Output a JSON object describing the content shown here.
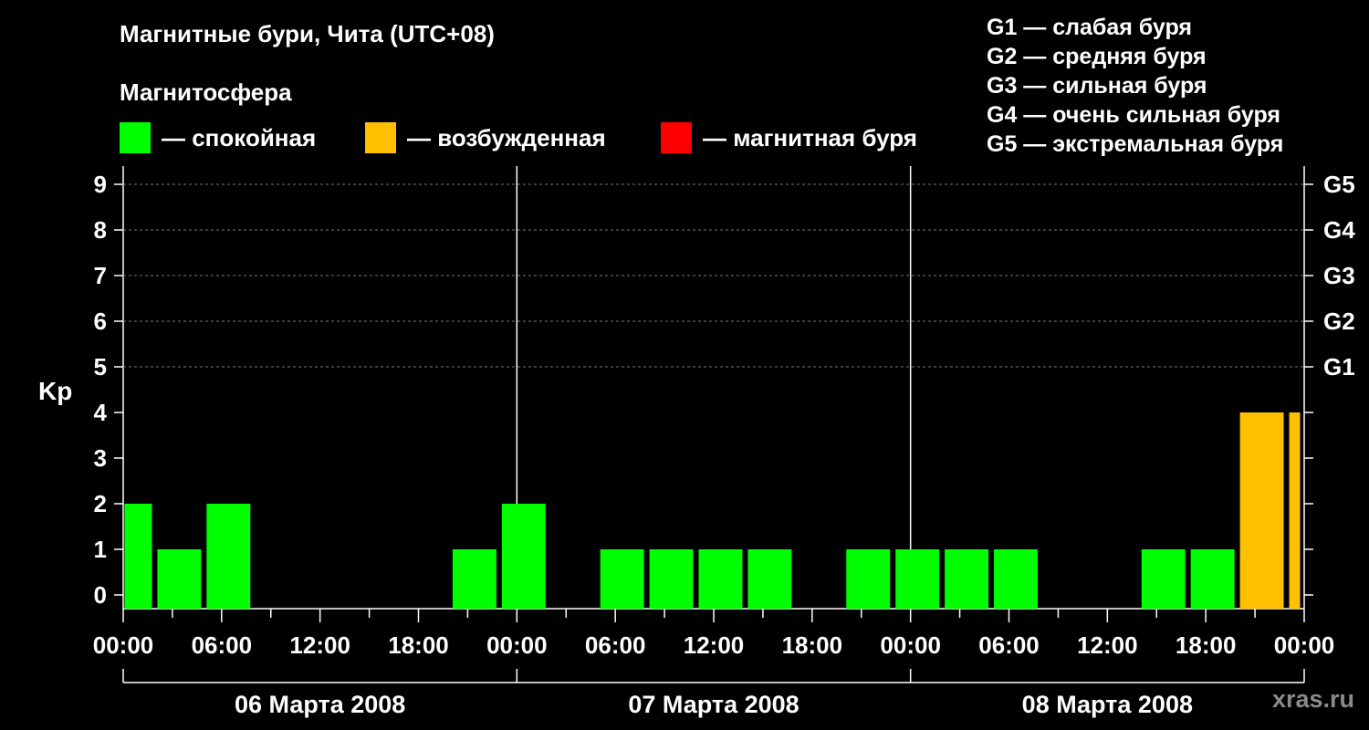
{
  "chart_data": {
    "type": "bar",
    "title": "Магнитные бури, Чита (UTC+08)",
    "subtitle": "Магнитосфера",
    "ylabel": "Kp",
    "ylim": [
      0,
      9
    ],
    "yticks": [
      0,
      1,
      2,
      3,
      4,
      5,
      6,
      7,
      8,
      9
    ],
    "right_axis_labels": [
      {
        "kp": 5,
        "label": "G1"
      },
      {
        "kp": 6,
        "label": "G2"
      },
      {
        "kp": 7,
        "label": "G3"
      },
      {
        "kp": 8,
        "label": "G4"
      },
      {
        "kp": 9,
        "label": "G5"
      }
    ],
    "xlim_hours": [
      0,
      72
    ],
    "xtick_labels": [
      "00:00",
      "06:00",
      "12:00",
      "18:00",
      "00:00",
      "06:00",
      "12:00",
      "18:00",
      "00:00",
      "06:00",
      "12:00",
      "18:00",
      "00:00"
    ],
    "days": [
      "06 Марта 2008",
      "07 Марта 2008",
      "08 Марта 2008"
    ],
    "grid": "dashed horizontal at 5-9",
    "status_colors": {
      "calm": "#00ff00",
      "active": "#ffc000",
      "storm": "#ff0000"
    },
    "legend": [
      {
        "label": "— спокойная",
        "color": "#00ff00"
      },
      {
        "label": "— возбужденная",
        "color": "#ffc000"
      },
      {
        "label": "— магнитная буря",
        "color": "#ff0000"
      }
    ],
    "bars": [
      {
        "start": 0,
        "end": 2,
        "kp": 2
      },
      {
        "start": 2,
        "end": 5,
        "kp": 1
      },
      {
        "start": 5,
        "end": 8,
        "kp": 2
      },
      {
        "start": 20,
        "end": 23,
        "kp": 1
      },
      {
        "start": 23,
        "end": 26,
        "kp": 2
      },
      {
        "start": 29,
        "end": 32,
        "kp": 1
      },
      {
        "start": 32,
        "end": 35,
        "kp": 1
      },
      {
        "start": 35,
        "end": 38,
        "kp": 1
      },
      {
        "start": 38,
        "end": 41,
        "kp": 1
      },
      {
        "start": 44,
        "end": 47,
        "kp": 1
      },
      {
        "start": 47,
        "end": 50,
        "kp": 1
      },
      {
        "start": 50,
        "end": 53,
        "kp": 1
      },
      {
        "start": 53,
        "end": 56,
        "kp": 1
      },
      {
        "start": 62,
        "end": 65,
        "kp": 1
      },
      {
        "start": 65,
        "end": 68,
        "kp": 1
      },
      {
        "start": 68,
        "end": 71,
        "kp": 4
      },
      {
        "start": 71,
        "end": 72,
        "kp": 4
      }
    ]
  },
  "gscale": [
    "G1 — слабая буря",
    "G2 — средняя буря",
    "G3 — сильная буря",
    "G4 — очень сильная буря",
    "G5 — экстремальная буря"
  ],
  "watermark": "xras.ru"
}
